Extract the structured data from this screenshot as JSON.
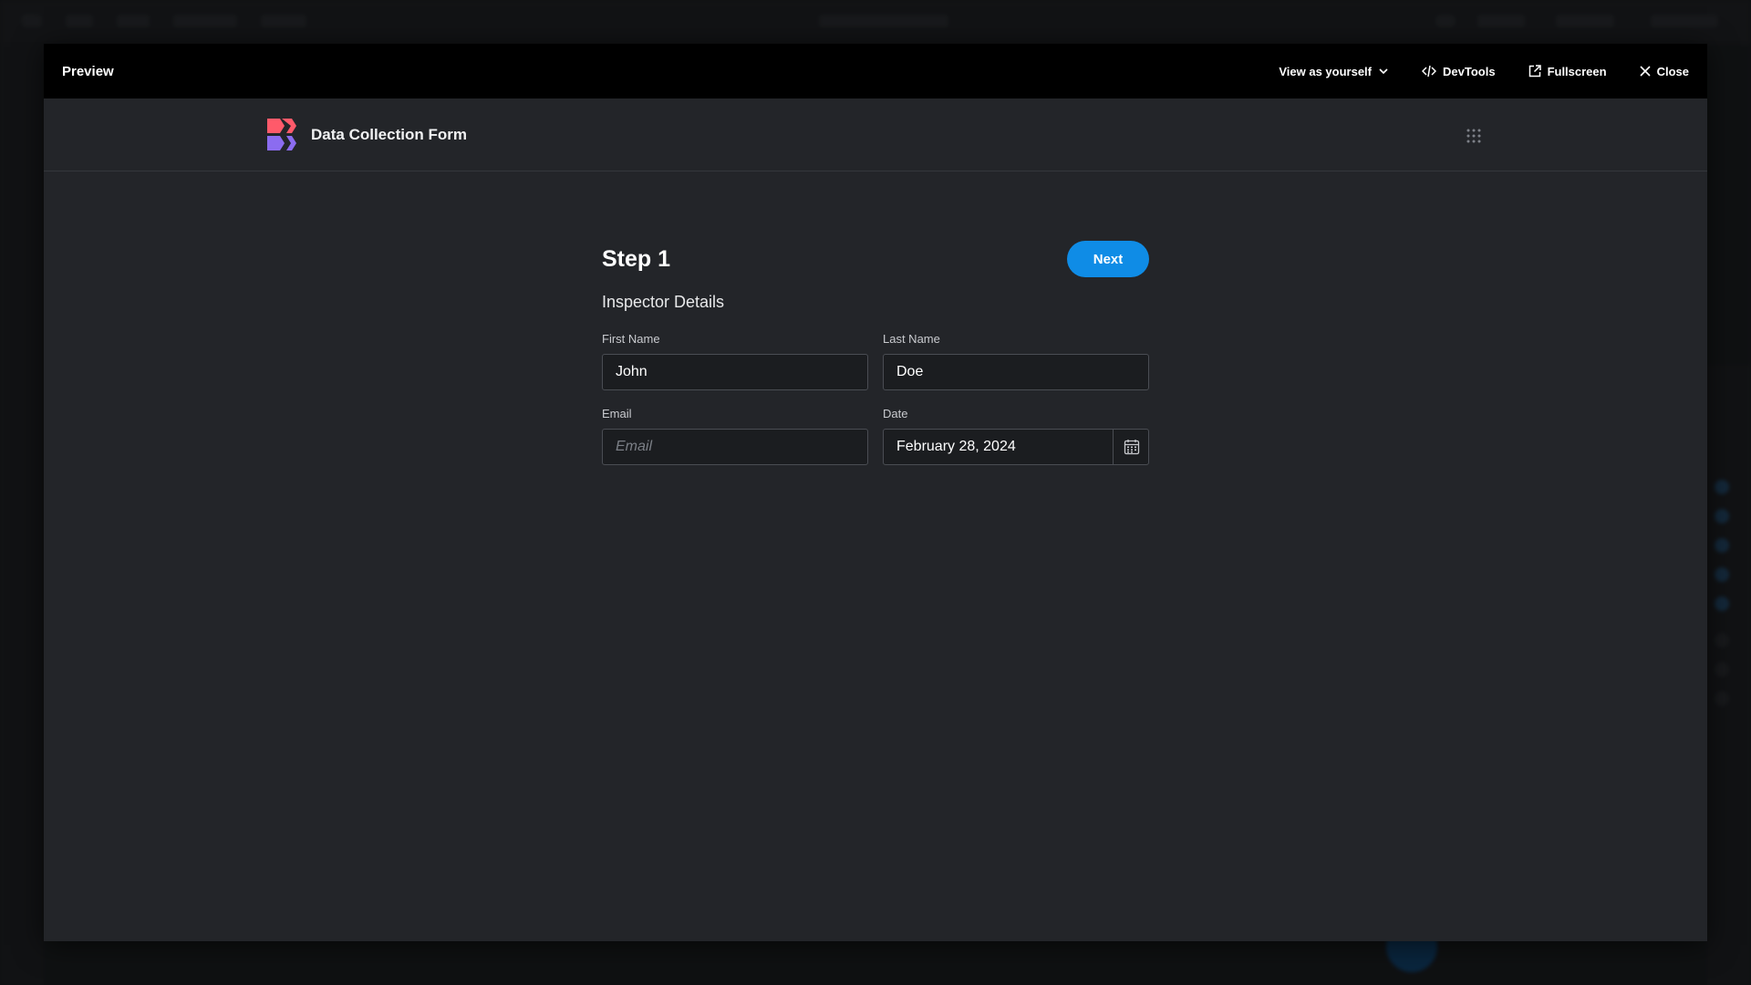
{
  "modal": {
    "title": "Preview",
    "actions": {
      "view_as": "View as yourself",
      "devtools": "DevTools",
      "fullscreen": "Fullscreen",
      "close": "Close"
    }
  },
  "app": {
    "title": "Data Collection Form",
    "logo_colors": [
      "#ff5a6a",
      "#8b6cf0"
    ],
    "icons": [
      "chevron-down-icon",
      "code-icon",
      "external-link-icon",
      "close-icon",
      "grid-icon",
      "calendar-icon"
    ]
  },
  "form": {
    "step_title": "Step 1",
    "next_label": "Next",
    "section_title": "Inspector Details",
    "fields": {
      "first_name": {
        "label": "First Name",
        "value": "John"
      },
      "last_name": {
        "label": "Last Name",
        "value": "Doe"
      },
      "email": {
        "label": "Email",
        "placeholder": "Email",
        "value": ""
      },
      "date": {
        "label": "Date",
        "value": "February 28, 2024"
      }
    }
  },
  "colors": {
    "accent": "#0f8ce6",
    "modal_header": "#000000",
    "surface": "#232529"
  }
}
